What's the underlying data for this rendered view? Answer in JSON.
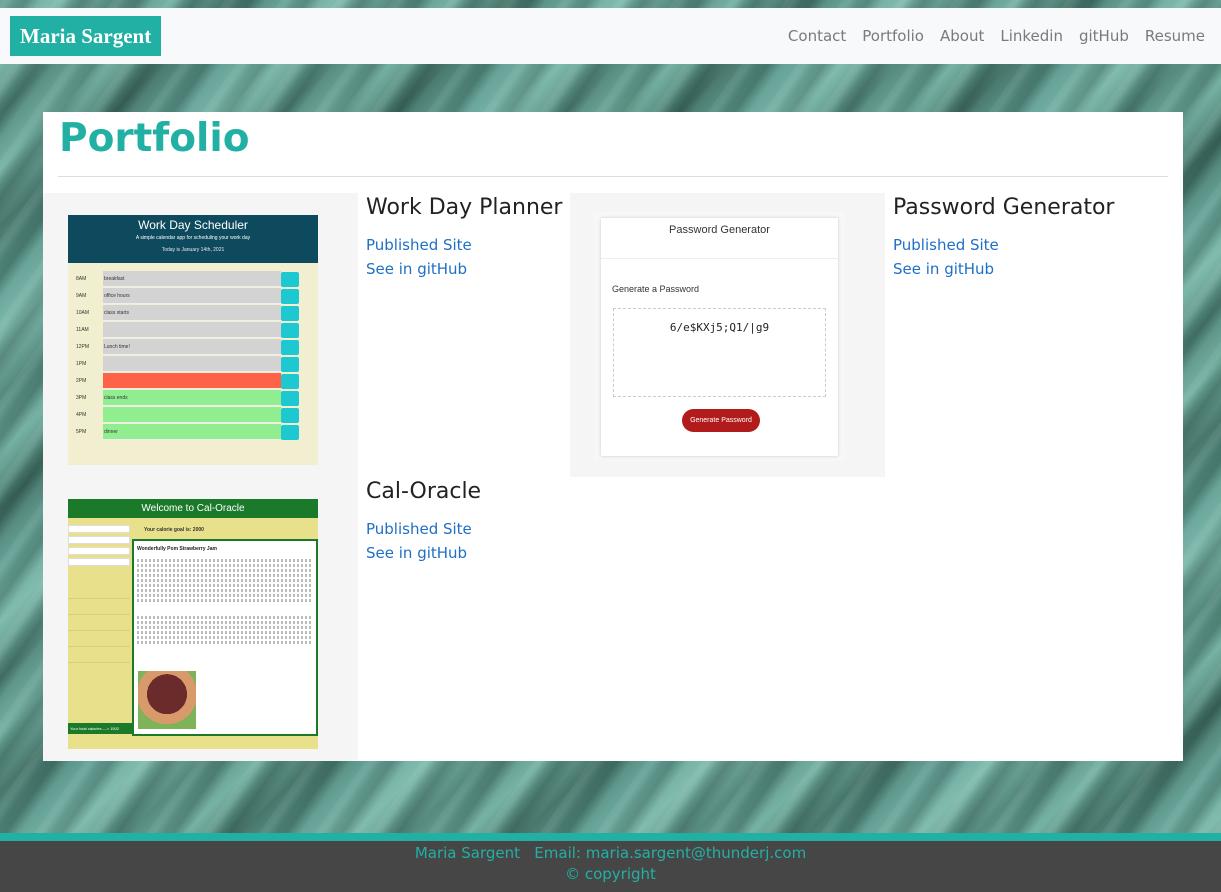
{
  "nav": {
    "brand": "Maria Sargent",
    "links": [
      "Contact",
      "Portfolio",
      "About",
      "Linkedin",
      "gitHub",
      "Resume"
    ]
  },
  "main": {
    "title": "Portfolio",
    "projects": [
      {
        "title": "Work Day Planner",
        "published": "Published Site",
        "github": "See in gitHub",
        "thumbnail": {
          "heading": "Work Day Scheduler",
          "subheading": "A simple calendar app for scheduling your work day",
          "date": "Today is January 14th, 2021",
          "rows": [
            {
              "hour": "8AM",
              "text": "breakfast",
              "color": "#d3d3d3"
            },
            {
              "hour": "9AM",
              "text": "office hours",
              "color": "#d3d3d3"
            },
            {
              "hour": "10AM",
              "text": "class starts",
              "color": "#d3d3d3"
            },
            {
              "hour": "11AM",
              "text": "",
              "color": "#d3d3d3"
            },
            {
              "hour": "12PM",
              "text": "Lunch time!",
              "color": "#d3d3d3"
            },
            {
              "hour": "1PM",
              "text": "",
              "color": "#d3d3d3"
            },
            {
              "hour": "2PM",
              "text": "",
              "color": "#ff6347"
            },
            {
              "hour": "3PM",
              "text": "class ends",
              "color": "#90ee90"
            },
            {
              "hour": "4PM",
              "text": "",
              "color": "#90ee90"
            },
            {
              "hour": "5PM",
              "text": "dinner",
              "color": "#90ee90"
            }
          ]
        }
      },
      {
        "title": "Password Generator",
        "published": "Published Site",
        "github": "See in gitHub",
        "thumbnail": {
          "heading": "Password Generator",
          "subheading": "Generate a Password",
          "password": "6/e$KXj5;Q1/|g9",
          "button": "Generate Password"
        }
      },
      {
        "title": "Cal-Oracle",
        "published": "Published Site",
        "github": "See in gitHub",
        "thumbnail": {
          "heading": "Welcome to Cal-Oracle",
          "goal": "Your calorie goal is: 2000",
          "recipe": "Wonderfully Pom Strawberry Jam",
          "footer": "Your total calories ---> 1502"
        }
      }
    ]
  },
  "footer": {
    "line1": "Maria Sargent   Email: maria.sargent@thunderj.com",
    "line2": "© copyright"
  },
  "colors": {
    "accent": "#22b0a4",
    "link": "#1f6fc5",
    "footer_bg": "#464646"
  }
}
